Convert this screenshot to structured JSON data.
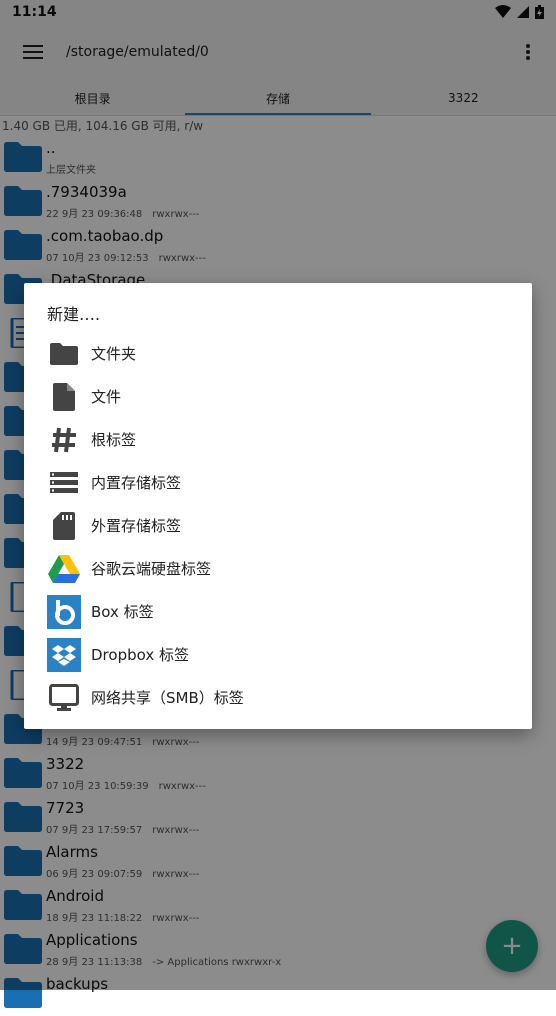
{
  "status_bar": {
    "time": "11:14"
  },
  "app_bar": {
    "path": "/storage/emulated/0"
  },
  "tabs": [
    {
      "label": "根目录"
    },
    {
      "label": "存储"
    },
    {
      "label": "3322"
    }
  ],
  "storage_info": "1.40 GB 已用, 104.16 GB 可用, r/w",
  "files": [
    {
      "name": "..",
      "date": "上层文件夹",
      "perm": ""
    },
    {
      "name": ".7934039a",
      "date": "22 9月 23 09:36:48",
      "perm": "rwxrwx---"
    },
    {
      "name": ".com.taobao.dp",
      "date": "07 10月 23 09:12:53",
      "perm": "rwxrwx---"
    },
    {
      "name": ".DataStorage",
      "date": "",
      "perm": ""
    },
    {
      "name": "",
      "date": "14 9月 23 09:47:51",
      "perm": "rwxrwx---"
    },
    {
      "name": "3322",
      "date": "07 10月 23 10:59:39",
      "perm": "rwxrwx---"
    },
    {
      "name": "7723",
      "date": "07 9月 23 17:59:57",
      "perm": "rwxrwx---"
    },
    {
      "name": "Alarms",
      "date": "06 9月 23 09:07:59",
      "perm": "rwxrwx---"
    },
    {
      "name": "Android",
      "date": "18 9月 23 11:18:22",
      "perm": "rwxrwx---"
    },
    {
      "name": "Applications",
      "date": "28 9月 23 11:13:38",
      "perm": "-> Applications  rwxrwxr-x"
    },
    {
      "name": "backups",
      "date": "",
      "perm": ""
    }
  ],
  "dialog": {
    "title": "新建….",
    "options": [
      {
        "label": "文件夹",
        "icon": "folder-icon"
      },
      {
        "label": "文件",
        "icon": "file-icon"
      },
      {
        "label": "根标签",
        "icon": "hash-icon"
      },
      {
        "label": "内置存储标签",
        "icon": "storage-icon"
      },
      {
        "label": "外置存储标签",
        "icon": "sd-card-icon"
      },
      {
        "label": "谷歌云端硬盘标签",
        "icon": "google-drive-icon"
      },
      {
        "label": "Box 标签",
        "icon": "box-icon"
      },
      {
        "label": "Dropbox 标签",
        "icon": "dropbox-icon"
      },
      {
        "label": "网络共享（SMB）标签",
        "icon": "monitor-icon"
      }
    ]
  },
  "fab": {
    "label": "+"
  },
  "colors": {
    "folder": "#1a6fb3",
    "accent": "#2a82c4",
    "fab": "#1e9c82"
  }
}
